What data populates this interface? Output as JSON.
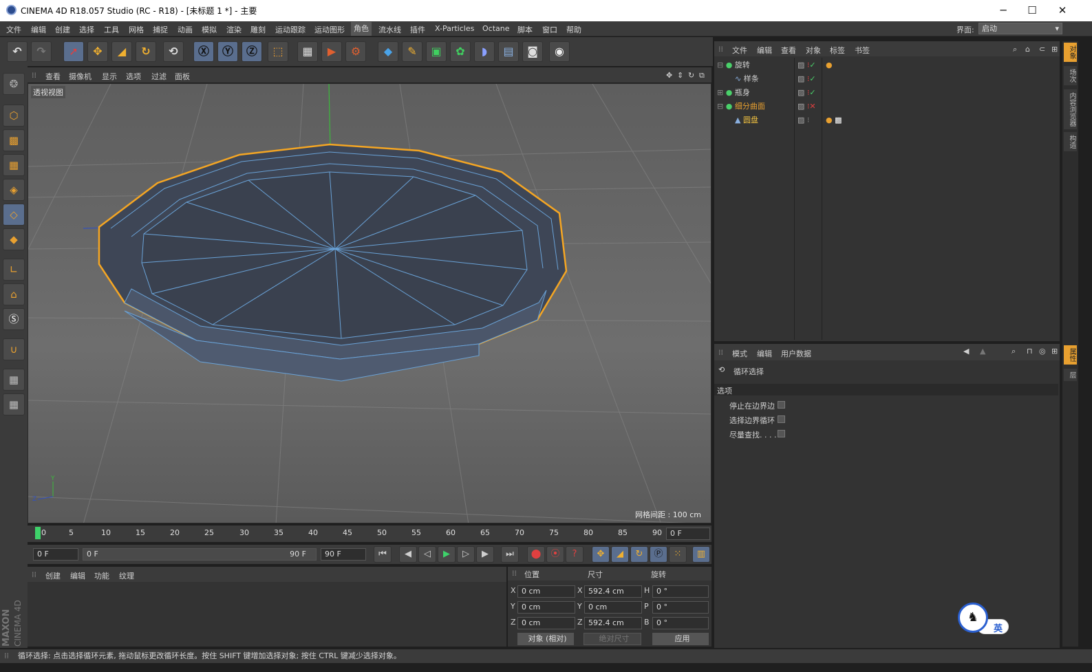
{
  "window": {
    "title": "CINEMA 4D R18.057 Studio (RC - R18) - [未标题 1 *] - 主要",
    "min": "─",
    "max": "☐",
    "close": "✕"
  },
  "menubar": {
    "items": [
      "文件",
      "编辑",
      "创建",
      "选择",
      "工具",
      "网格",
      "捕捉",
      "动画",
      "模拟",
      "渲染",
      "雕刻",
      "运动跟踪",
      "运动图形",
      "角色",
      "流水线",
      "插件",
      "X-Particles",
      "Octane",
      "脚本",
      "窗口",
      "帮助"
    ],
    "active": "角色",
    "layout_label": "界面:",
    "layout_value": "启动"
  },
  "viewport": {
    "menu": [
      "查看",
      "摄像机",
      "显示",
      "选项",
      "过滤",
      "面板"
    ],
    "label": "透视视图",
    "grid": "网格间距 : 100 cm"
  },
  "timeline": {
    "ticks": [
      "0",
      "5",
      "10",
      "15",
      "20",
      "25",
      "30",
      "35",
      "40",
      "45",
      "50",
      "55",
      "60",
      "65",
      "70",
      "75",
      "80",
      "85",
      "90"
    ],
    "current": "0 F"
  },
  "anim": {
    "start": "0 F",
    "range_start": "0 F",
    "range_end": "90 F",
    "end": "90 F"
  },
  "material": {
    "menu": [
      "创建",
      "编辑",
      "功能",
      "纹理"
    ]
  },
  "coords": {
    "headers": [
      "位置",
      "尺寸",
      "旋转"
    ],
    "rows": [
      {
        "axis": "X",
        "pos": "0 cm",
        "size_axis": "X",
        "size": "592.4 cm",
        "rot_axis": "H",
        "rot": "0 °"
      },
      {
        "axis": "Y",
        "pos": "0 cm",
        "size_axis": "Y",
        "size": "0 cm",
        "rot_axis": "P",
        "rot": "0 °"
      },
      {
        "axis": "Z",
        "pos": "0 cm",
        "size_axis": "Z",
        "size": "592.4 cm",
        "rot_axis": "B",
        "rot": "0 °"
      }
    ],
    "mode": "对象 (相对)",
    "size_mode": "绝对尺寸",
    "apply": "应用"
  },
  "objects": {
    "menu": [
      "文件",
      "编辑",
      "查看",
      "对象",
      "标签",
      "书签"
    ],
    "items": [
      {
        "name": "旋转",
        "color": "#cfcfcf",
        "indent": 0
      },
      {
        "name": "样条",
        "color": "#cfcfcf",
        "indent": 1
      },
      {
        "name": "瓶身",
        "color": "#cfcfcf",
        "indent": 0
      },
      {
        "name": "细分曲面",
        "color": "#e8a030",
        "indent": 0
      },
      {
        "name": "圆盘",
        "color": "#f0c040",
        "indent": 1
      }
    ]
  },
  "attributes": {
    "menu": [
      "模式",
      "编辑",
      "用户数据"
    ],
    "tool": "循环选择",
    "section": "选项",
    "options": [
      "停止在边界边",
      "选择边界循环",
      "尽量查找. . . ."
    ]
  },
  "right_tabs": [
    "对象",
    "场次",
    "内容浏览器",
    "构造"
  ],
  "right_tabs2": [
    "属性",
    "层"
  ],
  "status": "循环选择: 点击选择循环元素, 拖动鼠标更改循环长度。按住 SHIFT 键增加选择对象; 按住 CTRL 键减少选择对象。",
  "brand": {
    "maxon": "MAXON",
    "c4d": "CINEMA 4D"
  },
  "ime": "英",
  "colors": {
    "accent": "#e8a030",
    "selection": "#f5a623",
    "wire": "#6aa3d8"
  }
}
